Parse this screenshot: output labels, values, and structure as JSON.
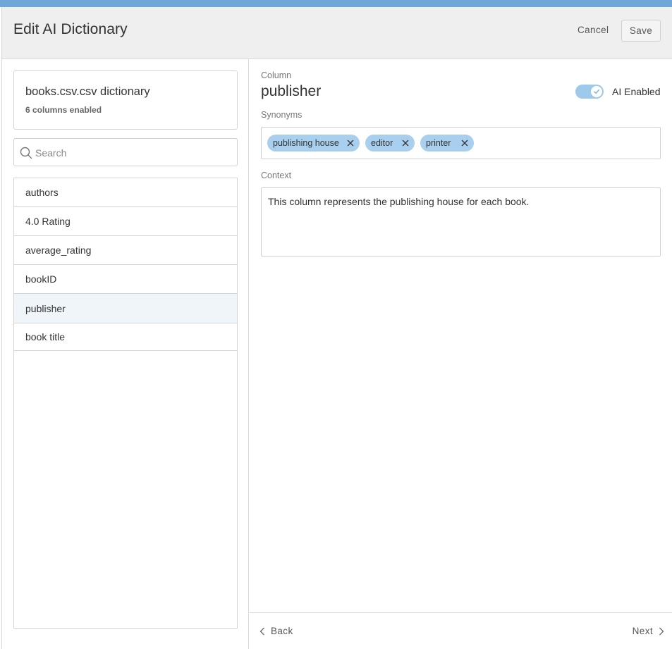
{
  "header": {
    "title": "Edit AI Dictionary",
    "cancel_label": "Cancel",
    "save_label": "Save"
  },
  "dictionary": {
    "title": "books.csv.csv dictionary",
    "subtitle": "6 columns enabled"
  },
  "search": {
    "placeholder": "Search",
    "value": ""
  },
  "columns": [
    {
      "label": "authors",
      "selected": false
    },
    {
      "label": "4.0 Rating",
      "selected": false
    },
    {
      "label": "average_rating",
      "selected": false
    },
    {
      "label": "bookID",
      "selected": false
    },
    {
      "label": "publisher",
      "selected": true
    },
    {
      "label": "book title",
      "selected": false
    }
  ],
  "detail": {
    "column_label": "Column",
    "column_name": "publisher",
    "ai_toggle_label": "AI Enabled",
    "ai_enabled": true,
    "synonyms_label": "Synonyms",
    "synonyms": [
      "publishing house",
      "editor",
      "printer"
    ],
    "context_label": "Context",
    "context_text": "This column represents the publishing house for each book."
  },
  "footer": {
    "back_label": "Back",
    "next_label": "Next"
  },
  "colors": {
    "accent_strip": "#6fa8d8",
    "chip_bg": "#a8d0ee",
    "toggle_on": "#9ec9ea",
    "selected_row": "#f0f5fa",
    "header_bg": "#efefef"
  },
  "icons": {
    "search": "search-icon",
    "chip_remove": "close-icon",
    "toggle_check": "check-icon",
    "back": "chevron-left-icon",
    "next": "chevron-right-icon"
  }
}
